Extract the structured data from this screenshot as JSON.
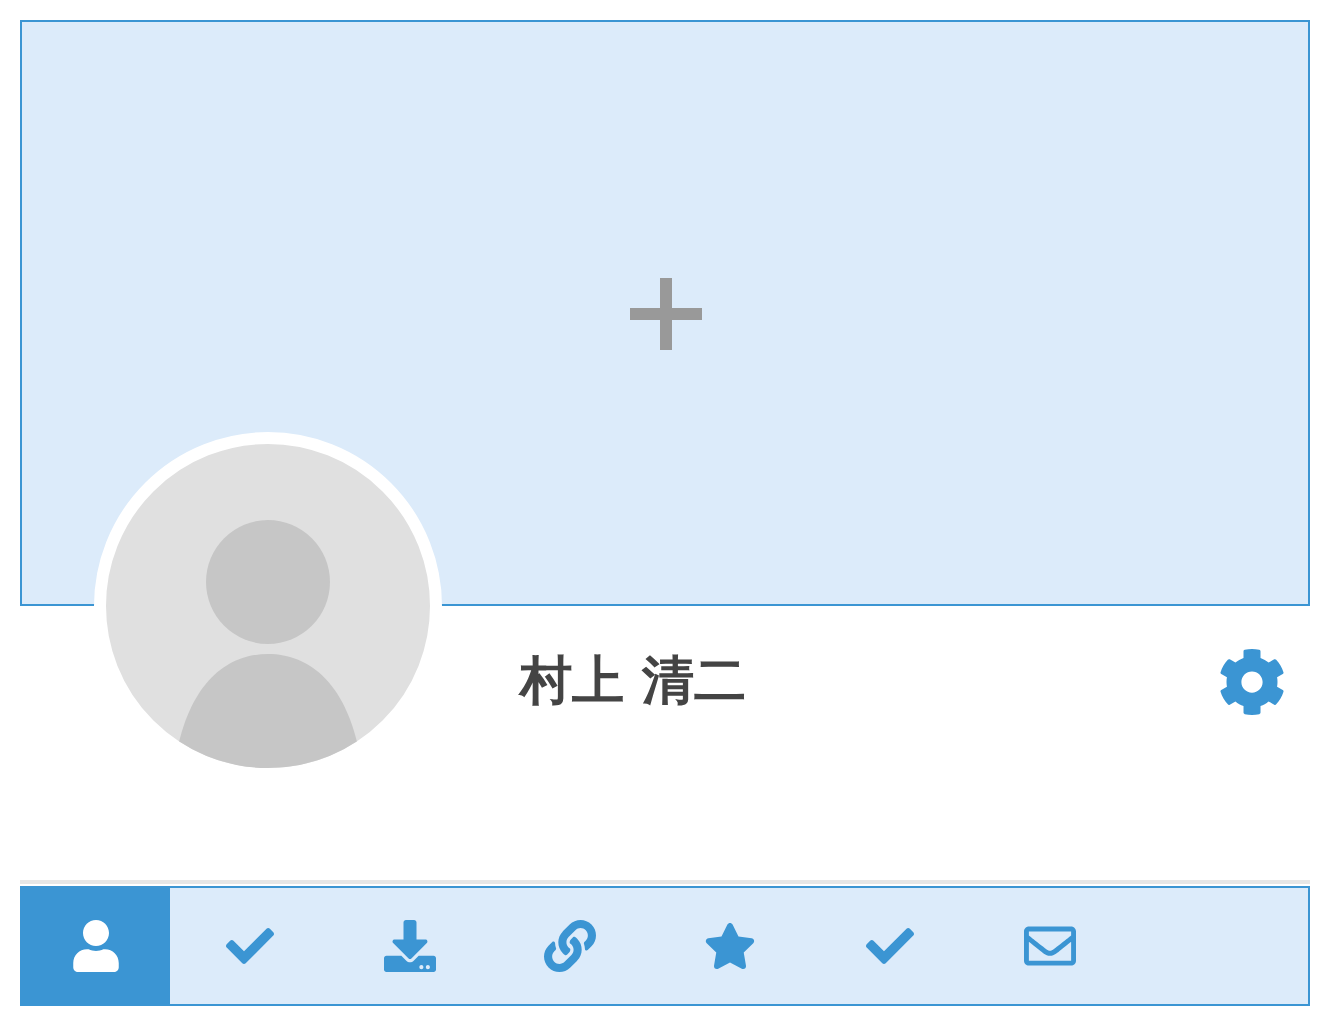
{
  "profile": {
    "name": "村上 清二"
  },
  "tabs": [
    {
      "kind": "user",
      "selected": true
    },
    {
      "kind": "check",
      "selected": false
    },
    {
      "kind": "download",
      "selected": false
    },
    {
      "kind": "link",
      "selected": false
    },
    {
      "kind": "star",
      "selected": false
    },
    {
      "kind": "check",
      "selected": false
    },
    {
      "kind": "mail",
      "selected": false
    }
  ]
}
